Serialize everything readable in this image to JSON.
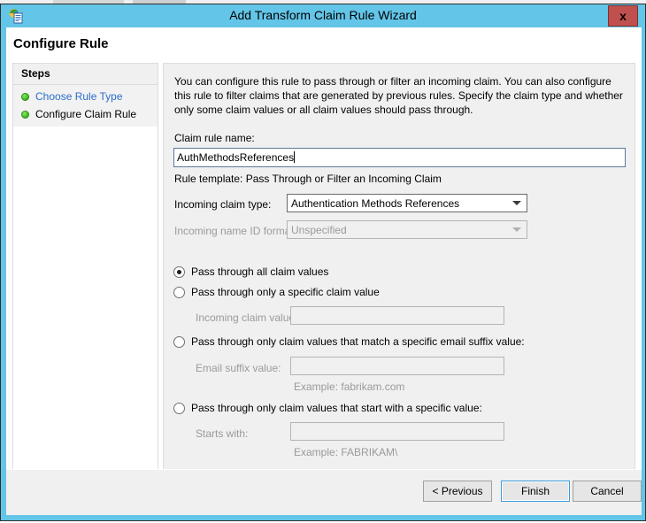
{
  "window": {
    "title": "Add Transform Claim Rule Wizard",
    "icon": "adfs-wizard-icon",
    "close_label": "x",
    "accent_color": "#63c5e8",
    "close_color": "#c0504d"
  },
  "page": {
    "heading": "Configure Rule"
  },
  "sidebar": {
    "header": "Steps",
    "items": [
      {
        "label": "Choose Rule Type",
        "state": "link"
      },
      {
        "label": "Configure Claim Rule",
        "state": "current"
      }
    ]
  },
  "main": {
    "intro": "You can configure this rule to pass through or filter an incoming claim. You can also configure this rule to filter claims that are generated by previous rules. Specify the claim type and whether only some claim values or all claim values should pass through.",
    "claim_rule_name_label": "Claim rule name:",
    "claim_rule_name_value": "AuthMethodsReferences",
    "rule_template_text": "Rule template: Pass Through or Filter an Incoming Claim",
    "incoming_claim_type_label": "Incoming claim type:",
    "incoming_claim_type_value": "Authentication Methods References",
    "incoming_name_id_format_label": "Incoming name ID format:",
    "incoming_name_id_format_value": "Unspecified",
    "options": [
      {
        "label": "Pass through all claim values",
        "selected": true
      },
      {
        "label": "Pass through only a specific claim value",
        "selected": false,
        "field_label": "Incoming claim value:",
        "field_value": ""
      },
      {
        "label": "Pass through only claim values that match a specific email suffix value:",
        "selected": false,
        "field_label": "Email suffix value:",
        "field_value": "",
        "example": "Example: fabrikam.com"
      },
      {
        "label": "Pass through only claim values that start with a specific value:",
        "selected": false,
        "field_label": "Starts with:",
        "field_value": "",
        "example": "Example: FABRIKAM\\"
      }
    ]
  },
  "footer": {
    "previous_label": "< Previous",
    "finish_label": "Finish",
    "cancel_label": "Cancel"
  }
}
